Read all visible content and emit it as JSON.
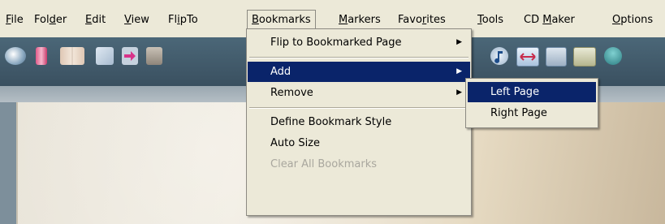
{
  "menubar": {
    "items": [
      {
        "label": "File",
        "mnemonic_index": 0
      },
      {
        "label": "Folder",
        "mnemonic_index": 3
      },
      {
        "label": "Edit",
        "mnemonic_index": 0
      },
      {
        "label": "View",
        "mnemonic_index": 0
      },
      {
        "label": "FlipTo",
        "mnemonic_index": 2
      },
      {
        "label": "Bookmarks",
        "mnemonic_index": 0
      },
      {
        "label": "Markers",
        "mnemonic_index": 0
      },
      {
        "label": "Favorites",
        "mnemonic_index": 4
      },
      {
        "label": "Tools",
        "mnemonic_index": 0
      },
      {
        "label": "CD Maker",
        "mnemonic_index": 3
      },
      {
        "label": "Options",
        "mnemonic_index": 0
      }
    ],
    "open_item": "Bookmarks"
  },
  "toolbar": {
    "icons": [
      "globe-icon",
      "red-book-icon",
      "open-book-icon",
      "page-icon",
      "arrow-right-icon",
      "page-stack-icon",
      "",
      "",
      "",
      "",
      "",
      "",
      "",
      "",
      "music-icon",
      "fit-width-icon",
      "page-view-icon",
      "thumbnail-icon",
      "tree-icon"
    ]
  },
  "bookmarks_menu": {
    "items": [
      {
        "label": "Flip to Bookmarked Page",
        "has_submenu": true,
        "state": "normal"
      },
      {
        "label": "Add",
        "has_submenu": true,
        "state": "highlight"
      },
      {
        "label": "Remove",
        "has_submenu": true,
        "state": "normal"
      },
      {
        "label": "Define Bookmark Style",
        "has_submenu": false,
        "state": "normal"
      },
      {
        "label": "Auto Size",
        "has_submenu": false,
        "state": "normal"
      },
      {
        "label": "Clear All Bookmarks",
        "has_submenu": false,
        "state": "disabled"
      }
    ]
  },
  "add_submenu": {
    "items": [
      {
        "label": "Left Page",
        "state": "highlight"
      },
      {
        "label": "Right Page",
        "state": "normal"
      }
    ]
  },
  "colors": {
    "menu_bg": "#ece9d8",
    "highlight": "#0a246a",
    "toolbar": "#4b6778"
  }
}
